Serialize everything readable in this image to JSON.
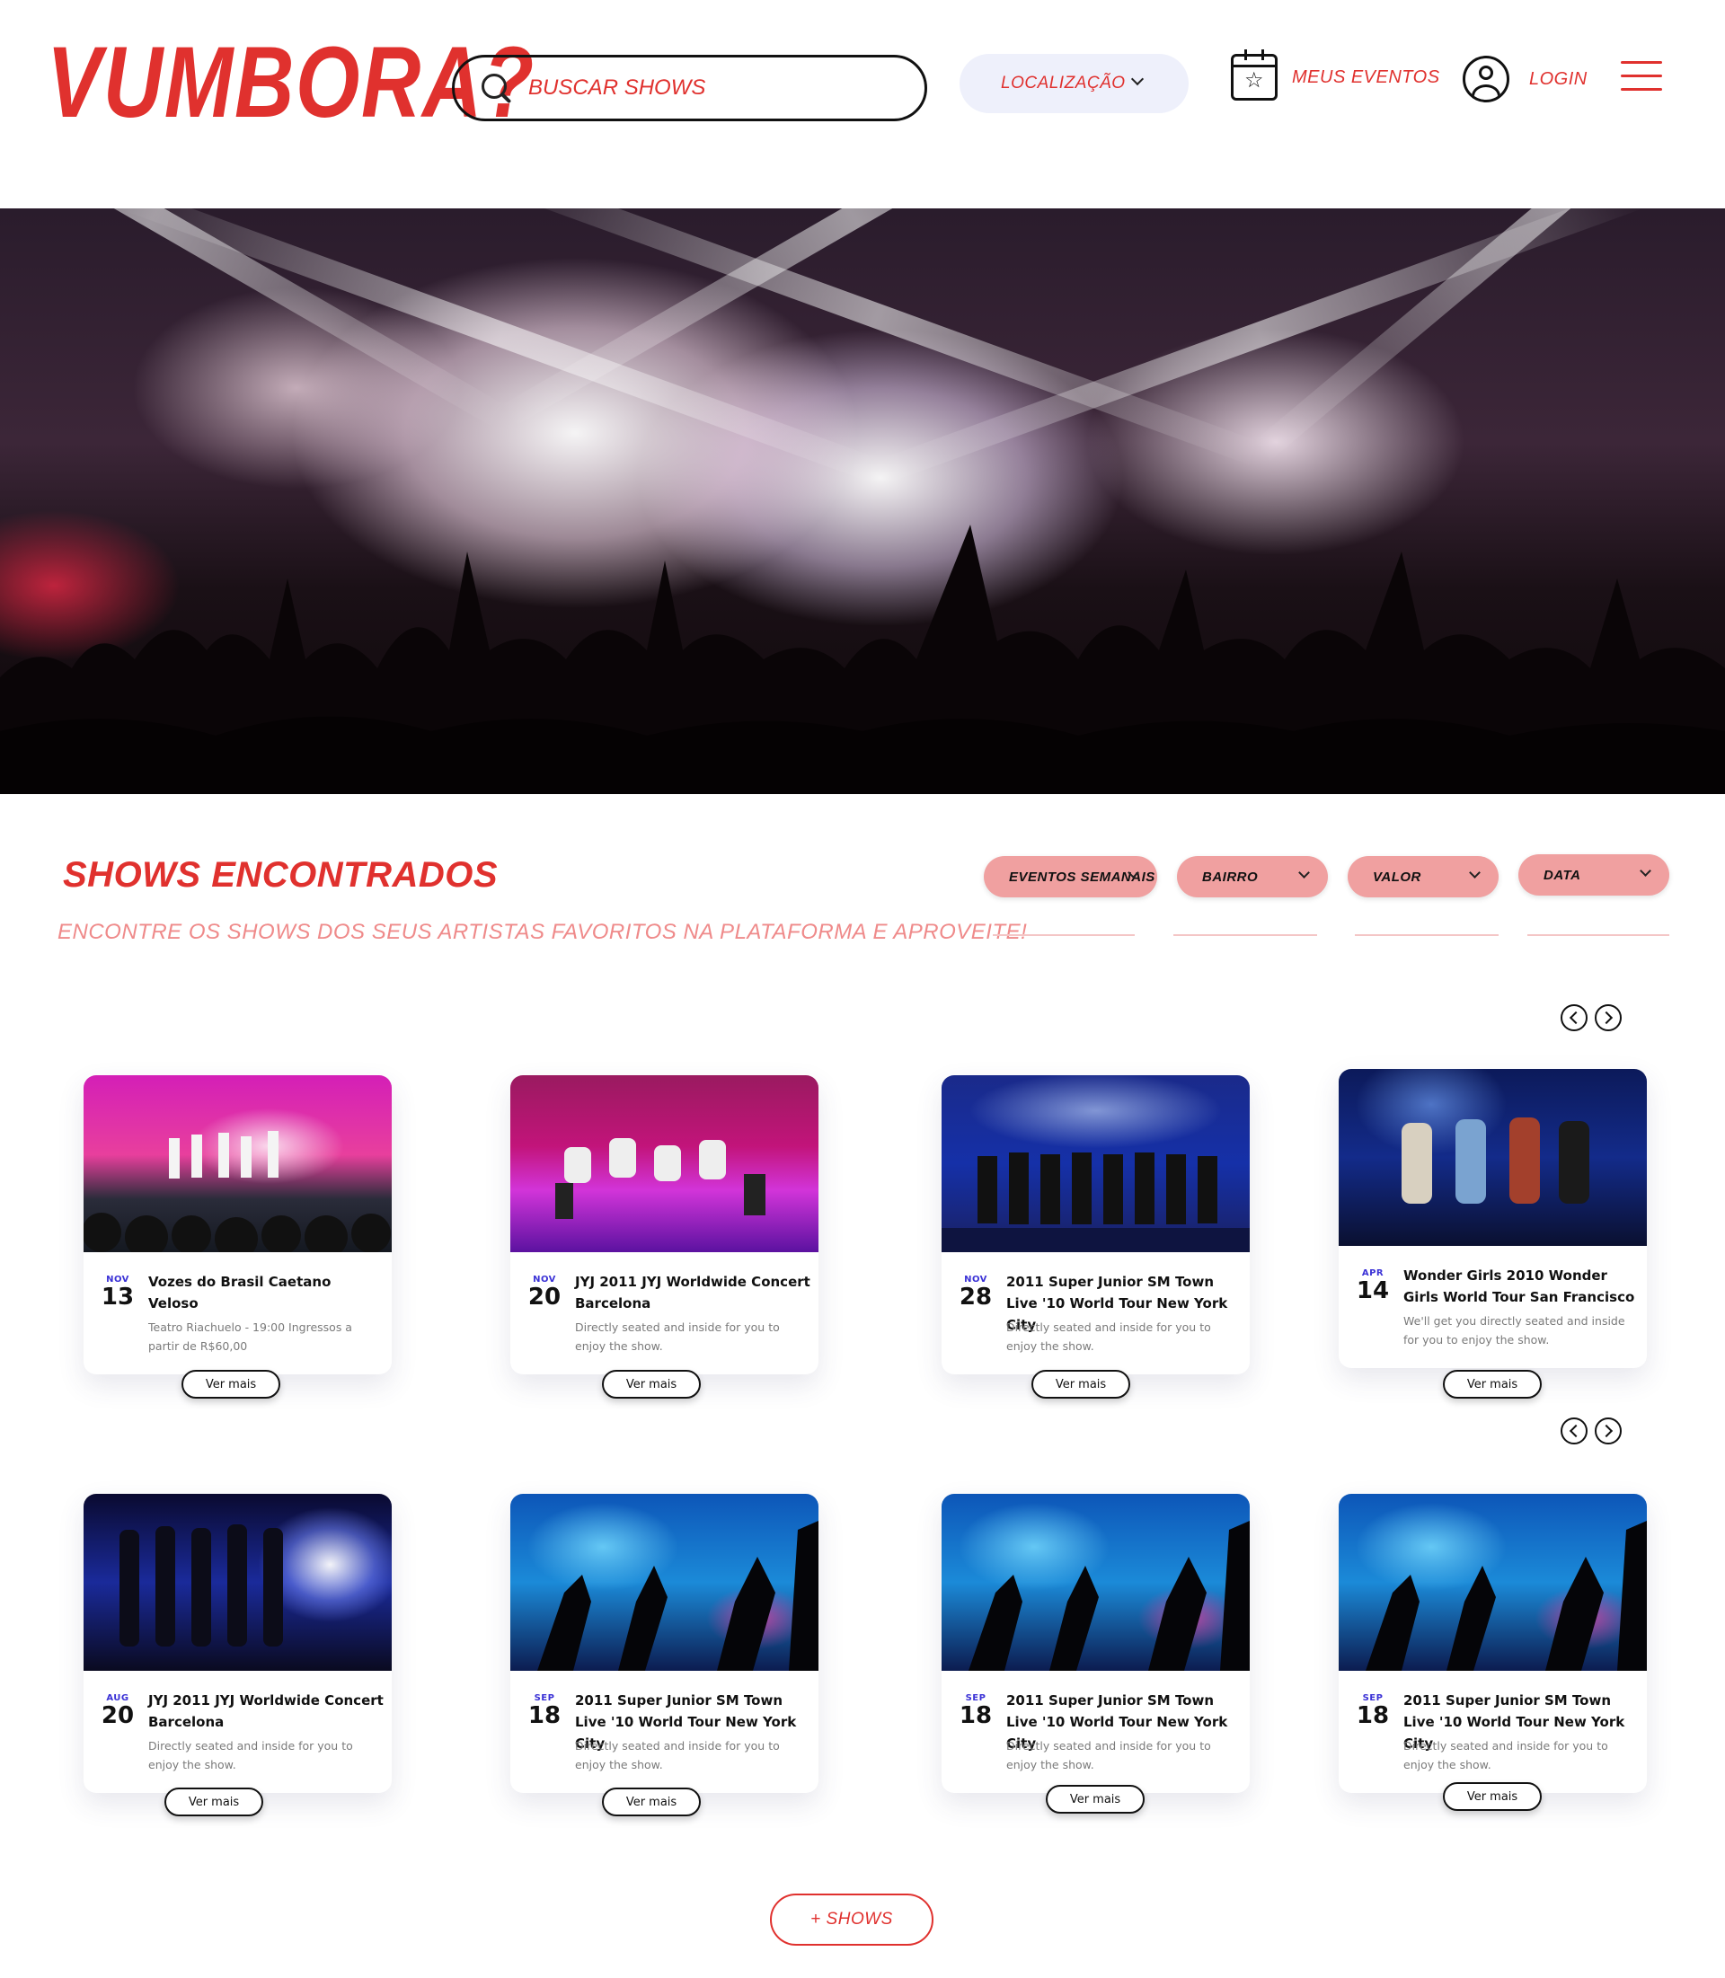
{
  "header": {
    "logo": "VUMBORA?",
    "search_placeholder": "BUSCAR SHOWS",
    "location_label": "LOCALIZAÇÃO",
    "my_events_label": "MEUS EVENTOS",
    "login_label": "LOGIN"
  },
  "section": {
    "title": "SHOWS ENCONTRADOS",
    "subtitle": "ENCONTRE OS SHOWS DOS SEUS ARTISTAS FAVORITOS NA PLATAFORMA E APROVEITE!",
    "filters": [
      "EVENTOS SEMANAIS",
      "BAIRRO",
      "VALOR",
      "DATA"
    ]
  },
  "cards": [
    {
      "month": "NOV",
      "day": "13",
      "title": "Vozes do Brasil Caetano Veloso",
      "desc": "Teatro Riachuelo - 19:00 Ingressos a partir de R$60,00",
      "button": "Ver mais"
    },
    {
      "month": "NOV",
      "day": "20",
      "title": "JYJ 2011 JYJ Worldwide Concert Barcelona",
      "desc": "Directly seated and inside for you to enjoy the show.",
      "button": "Ver mais"
    },
    {
      "month": "NOV",
      "day": "28",
      "title": "2011 Super Junior SM Town Live '10 World Tour New York City",
      "desc": "Directly seated and inside for you to enjoy the show.",
      "button": "Ver mais"
    },
    {
      "month": "APR",
      "day": "14",
      "title": "Wonder Girls 2010 Wonder Girls World Tour San Francisco",
      "desc": "We'll get you directly seated and inside for you to enjoy the show.",
      "button": "Ver mais"
    },
    {
      "month": "AUG",
      "day": "20",
      "title": "JYJ 2011 JYJ Worldwide Concert Barcelona",
      "desc": "Directly seated and inside for you to enjoy the show.",
      "button": "Ver mais"
    },
    {
      "month": "SEP",
      "day": "18",
      "title": "2011 Super Junior SM Town Live '10 World Tour New York City",
      "desc": "Directly seated and inside for you to enjoy the show.",
      "button": "Ver mais"
    },
    {
      "month": "SEP",
      "day": "18",
      "title": "2011 Super Junior SM Town Live '10 World Tour New York City",
      "desc": "Directly seated and inside for you to enjoy the show.",
      "button": "Ver mais"
    },
    {
      "month": "SEP",
      "day": "18",
      "title": "2011 Super Junior SM Town Live '10 World Tour New York City",
      "desc": "Directly seated and inside for you to enjoy the show.",
      "button": "Ver mais"
    }
  ],
  "more_shows_label": "+ SHOWS",
  "colors": {
    "brand": "#e0312e",
    "filter_bg": "#f0a0a0",
    "month": "#3b32d6"
  }
}
